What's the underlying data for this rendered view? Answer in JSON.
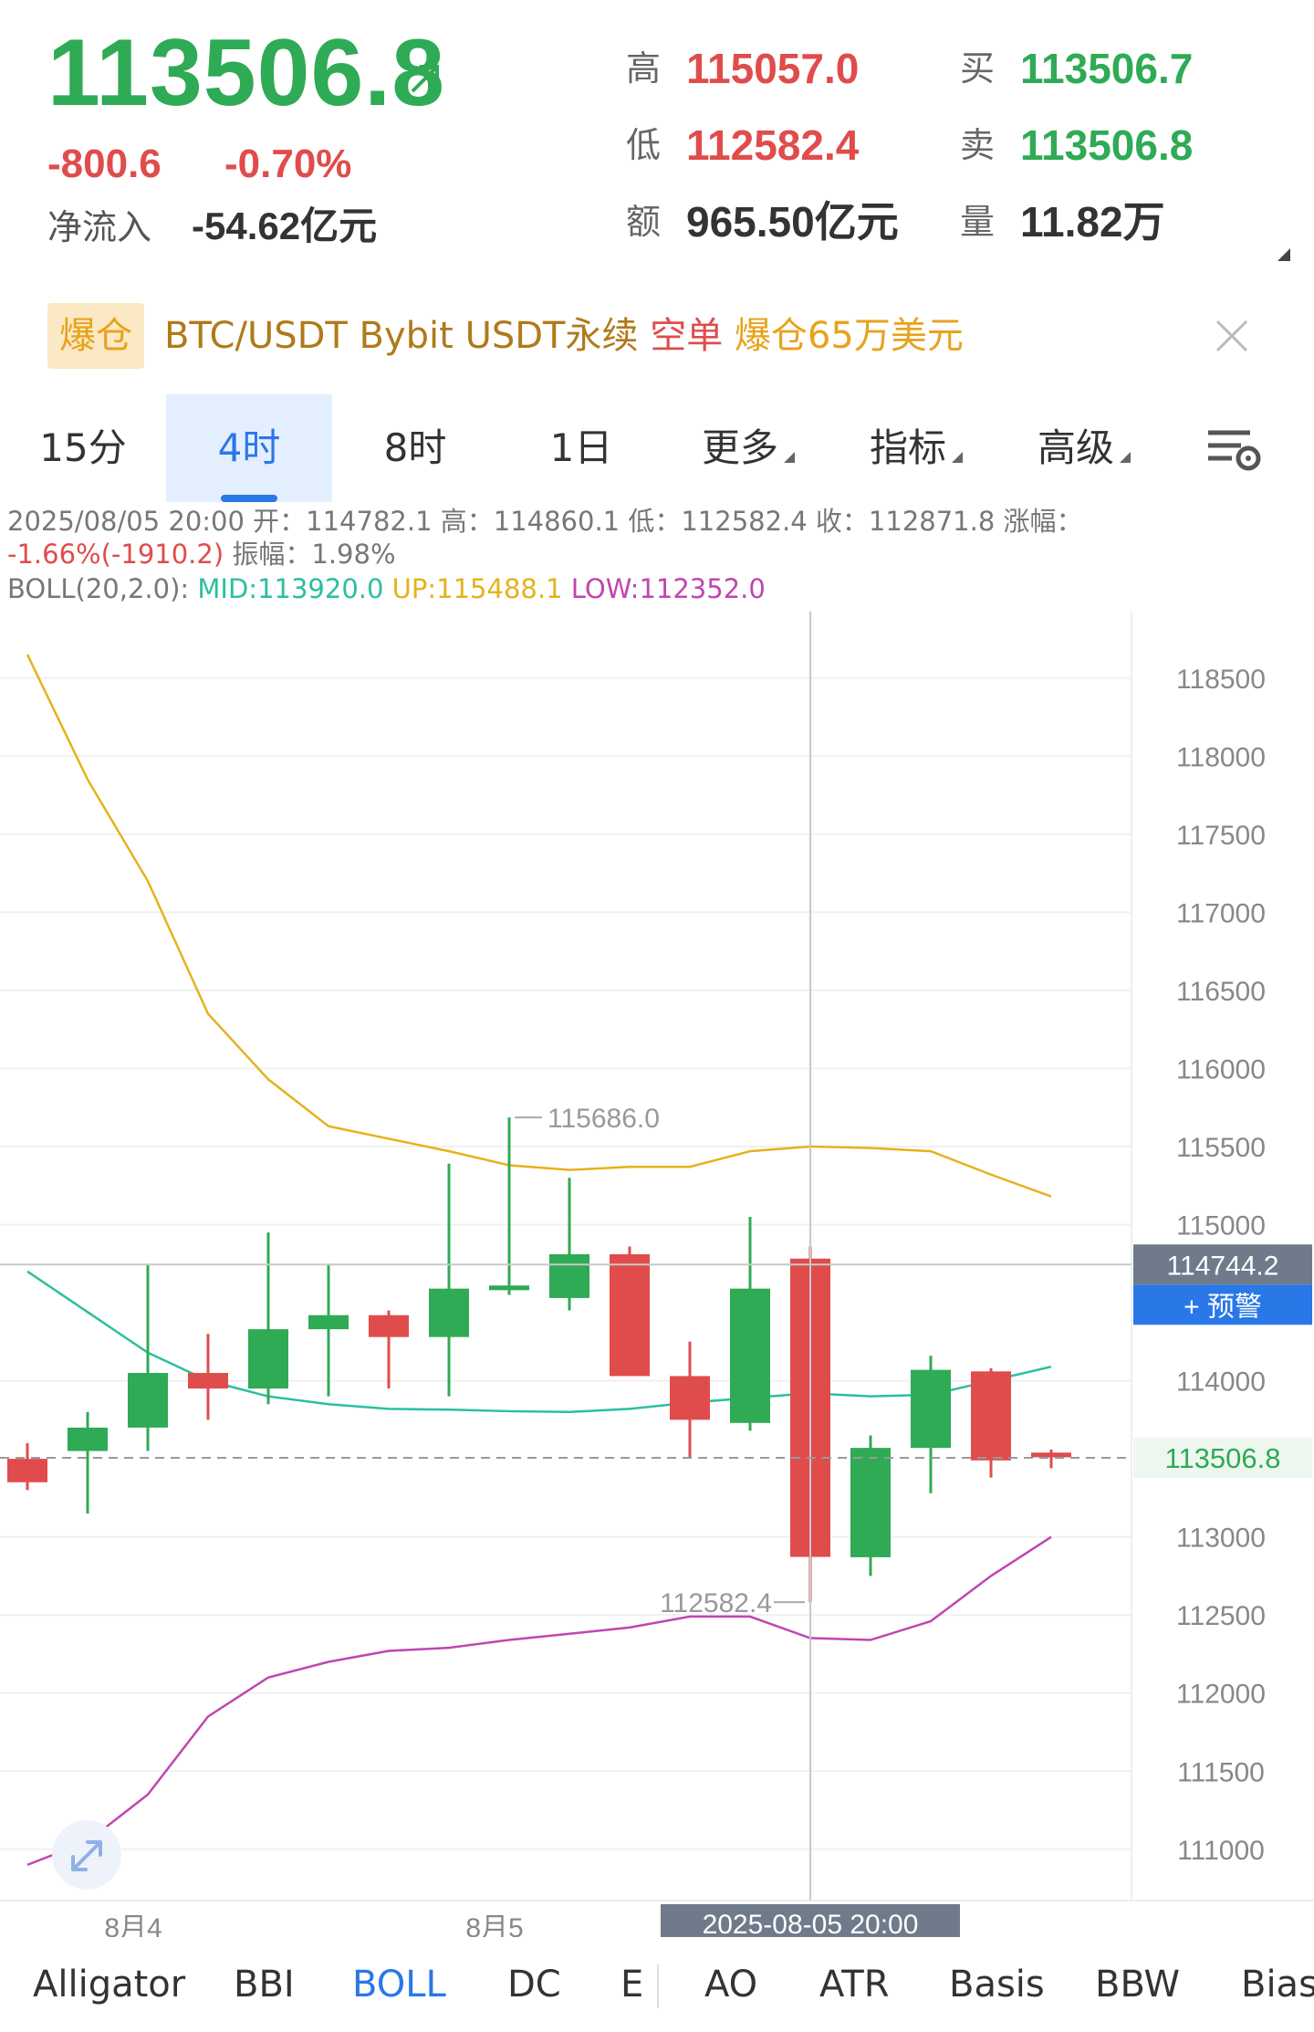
{
  "header": {
    "last_price": "113506.8",
    "change": "-800.6",
    "change_pct": "-0.70%",
    "net_inflow_label": "净流入",
    "net_inflow_value": "-54.62亿元",
    "high_label": "高",
    "high_value": "115057.0",
    "low_label": "低",
    "low_value": "112582.4",
    "amount_label": "额",
    "amount_value": "965.50亿元",
    "bid_label": "买",
    "bid_value": "113506.7",
    "ask_label": "卖",
    "ask_value": "113506.8",
    "volume_label": "量",
    "volume_value": "11.82万"
  },
  "banner": {
    "badge": "爆仓",
    "pair": "BTC/USDT Bybit USDT永续",
    "side": "空单",
    "amount": "爆仓65万美元"
  },
  "tabs": [
    {
      "label": "15分"
    },
    {
      "label": "4时"
    },
    {
      "label": "8时"
    },
    {
      "label": "1日"
    },
    {
      "label": "更多"
    },
    {
      "label": "指标"
    },
    {
      "label": "高级"
    }
  ],
  "info": {
    "line1": "2025/08/05 20:00 开：114782.1 高：114860.1 低：112582.4 收：112871.8 涨幅：",
    "line2_change": "-1.66%(-1910.2)",
    "line2_amp": " 振幅：1.98%",
    "boll_prefix": "BOLL(20,2.0): ",
    "boll_mid": "MID:113920.0",
    "boll_up": " UP:115488.1",
    "boll_low": " LOW:112352.0"
  },
  "indicators": [
    "Alligator",
    "BBI",
    "BOLL",
    "DC",
    "E",
    "AO",
    "ATR",
    "Basis",
    "BBW",
    "Bias"
  ],
  "colors": {
    "up": "#2faa55",
    "down": "#e04c4c",
    "boll_mid": "#2bbfa0",
    "boll_up": "#e5b21c",
    "boll_low": "#c046b0",
    "accent": "#2a77e8"
  },
  "chart_data": {
    "type": "candlestick",
    "y_ticks": [
      118500,
      118000,
      117500,
      117000,
      116500,
      116000,
      115500,
      115000,
      114000,
      113000,
      112500,
      112000,
      111500,
      111000
    ],
    "ylim": [
      110800,
      118750
    ],
    "x_labels": [
      "8月4",
      "8月5"
    ],
    "crosshair_time": "2025-08-05 20:00",
    "crosshair_price": "114744.2",
    "alert_label": "+ 预警",
    "last_price_label": "113506.8",
    "max_annotation": "115686.0",
    "min_annotation": "112582.4",
    "candles": [
      {
        "open": 113500,
        "high": 113600,
        "low": 113300,
        "close": 113350
      },
      {
        "open": 113550,
        "high": 113800,
        "low": 113150,
        "close": 113700
      },
      {
        "open": 113700,
        "high": 114750,
        "low": 113550,
        "close": 114050
      },
      {
        "open": 114050,
        "high": 114300,
        "low": 113750,
        "close": 113950
      },
      {
        "open": 113950,
        "high": 114950,
        "low": 113850,
        "close": 114330
      },
      {
        "open": 114330,
        "high": 114750,
        "low": 113900,
        "close": 114420
      },
      {
        "open": 114420,
        "high": 114450,
        "low": 113950,
        "close": 114280
      },
      {
        "open": 114280,
        "high": 115390,
        "low": 113900,
        "close": 114590
      },
      {
        "open": 114580,
        "high": 115686,
        "low": 114550,
        "close": 114610
      },
      {
        "open": 114530,
        "high": 115300,
        "low": 114450,
        "close": 114810
      },
      {
        "open": 114810,
        "high": 114860,
        "low": 114030,
        "close": 114030
      },
      {
        "open": 114030,
        "high": 114250,
        "low": 113510,
        "close": 113750
      },
      {
        "open": 113730,
        "high": 115050,
        "low": 113680,
        "close": 114590
      },
      {
        "open": 114782.1,
        "high": 114860.1,
        "low": 112582.4,
        "close": 112871.8
      },
      {
        "open": 112870,
        "high": 113650,
        "low": 112750,
        "close": 113570
      },
      {
        "open": 113570,
        "high": 114160,
        "low": 113280,
        "close": 114070
      },
      {
        "open": 114060,
        "high": 114080,
        "low": 113380,
        "close": 113490
      },
      {
        "open": 113540,
        "high": 113560,
        "low": 113440,
        "close": 113510
      }
    ],
    "boll_up": [
      118650,
      117850,
      117200,
      116350,
      115930,
      115630,
      115550,
      115470,
      115380,
      115350,
      115370,
      115370,
      115470,
      115500,
      115490,
      115470,
      115320,
      115180
    ],
    "boll_mid": [
      114700,
      114440,
      114180,
      114000,
      113900,
      113850,
      113820,
      113815,
      113805,
      113800,
      113820,
      113860,
      113890,
      113920,
      113900,
      113910,
      114000,
      114090
    ],
    "boll_low": [
      110900,
      111050,
      111350,
      111850,
      112100,
      112200,
      112270,
      112290,
      112340,
      112380,
      112420,
      112490,
      112490,
      112352,
      112340,
      112460,
      112750,
      113000
    ]
  }
}
